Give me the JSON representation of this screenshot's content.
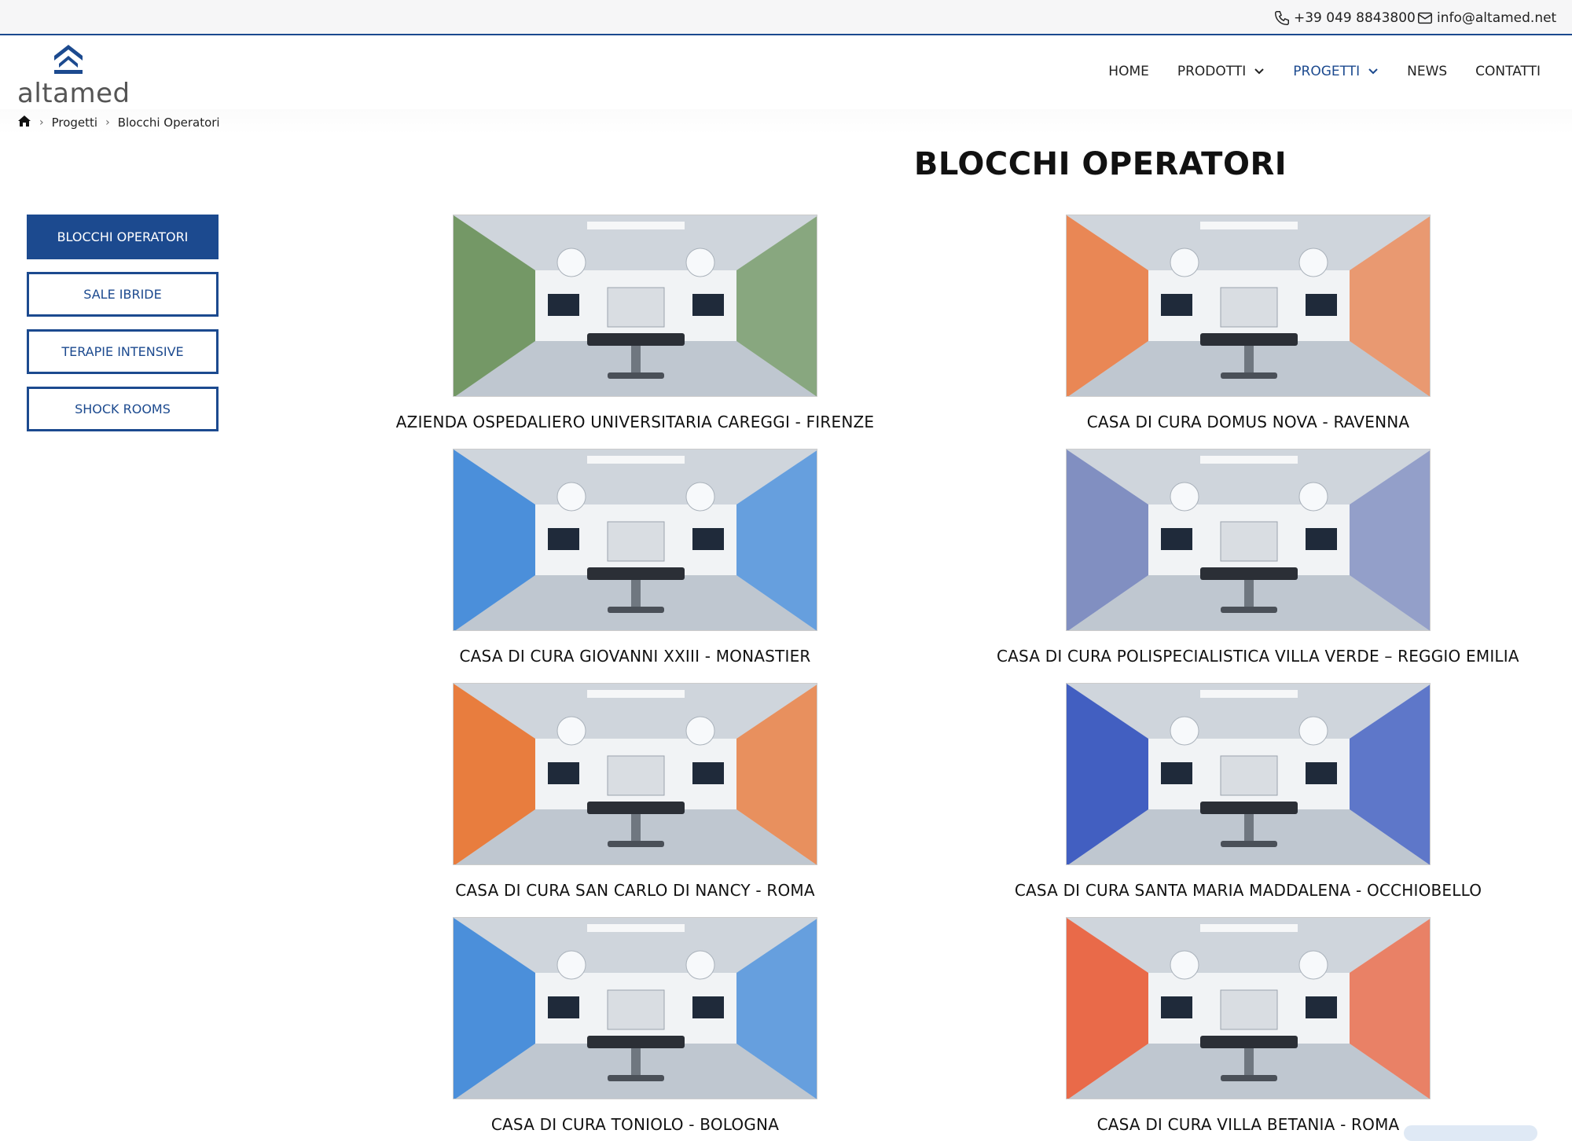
{
  "topbar": {
    "phone": "+39 049 8843800",
    "email": "info@altamed.net"
  },
  "brand": {
    "name": "altamed"
  },
  "nav": [
    {
      "label": "HOME",
      "dropdown": false,
      "active": false
    },
    {
      "label": "PRODOTTI",
      "dropdown": true,
      "active": false
    },
    {
      "label": "PROGETTI",
      "dropdown": true,
      "active": true
    },
    {
      "label": "NEWS",
      "dropdown": false,
      "active": false
    },
    {
      "label": "CONTATTI",
      "dropdown": false,
      "active": false
    }
  ],
  "breadcrumb": {
    "items": [
      "Progetti",
      "Blocchi Operatori"
    ]
  },
  "page": {
    "title": "BLOCCHI OPERATORI"
  },
  "sidebar": [
    {
      "label": "BLOCCHI OPERATORI",
      "active": true
    },
    {
      "label": "SALE IBRIDE",
      "active": false
    },
    {
      "label": "TERAPIE INTENSIVE",
      "active": false
    },
    {
      "label": "SHOCK ROOMS",
      "active": false
    }
  ],
  "projects": [
    {
      "caption": "AZIENDA OSPEDALIERO UNIVERSITARIA CAREGGI - FIRENZE",
      "accent": "#5f8a4e"
    },
    {
      "caption": "CASA DI CURA DOMUS NOVA - RAVENNA",
      "accent": "#e9763a"
    },
    {
      "caption": "CASA DI CURA GIOVANNI XXIII - MONASTIER",
      "accent": "#2f7fd6"
    },
    {
      "caption": "CASA DI CURA POLISPECIALISTICA VILLA VERDE – REGGIO EMILIA",
      "accent": "#6f7fb8"
    },
    {
      "caption": "CASA DI CURA SAN CARLO DI NANCY - ROMA",
      "accent": "#e86a1f"
    },
    {
      "caption": "CASA DI CURA SANTA MARIA MADDALENA - OCCHIOBELLO",
      "accent": "#2446b8"
    },
    {
      "caption": "CASA DI CURA TONIOLO - BOLOGNA",
      "accent": "#2f7fd6"
    },
    {
      "caption": "CASA DI CURA VILLA BETANIA - ROMA",
      "accent": "#e9542b"
    }
  ]
}
